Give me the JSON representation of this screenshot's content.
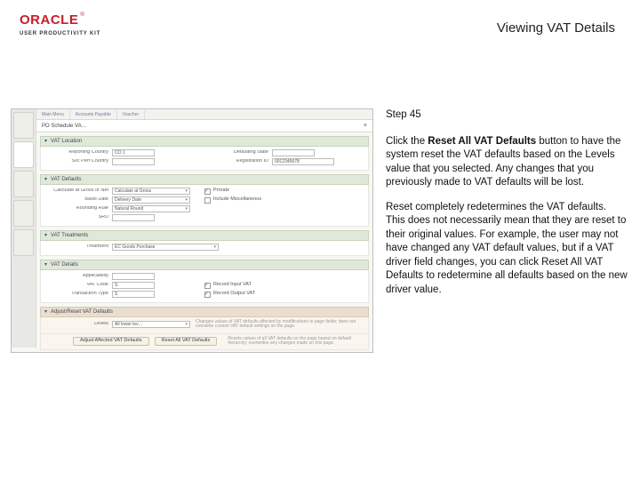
{
  "header": {
    "logo_main": "ORACLE",
    "logo_tm": "®",
    "logo_sub": "USER PRODUCTIVITY KIT",
    "page_title": "Viewing VAT Details"
  },
  "instruction": {
    "step_label": "Step 45",
    "para1_pre": "Click the ",
    "para1_bold": "Reset All VAT Defaults",
    "para1_post": " button to have the system reset the VAT defaults based on the Levels value that you selected. Any changes that you previously made to VAT defaults will be lost.",
    "para2": "Reset completely redetermines the VAT defaults. This does not necessarily mean that they are reset to their original values. For example, the user may not have changed any VAT default values, but if a VAT driver field changes, you can click Reset All VAT Defaults to redetermine all defaults based on the new driver value."
  },
  "app": {
    "tabs": [
      "Main Menu",
      "Accounts Payable",
      "Voucher"
    ],
    "win_title": "PO Schedule VA…",
    "sec_location": {
      "title": "VAT Location"
    },
    "loc": {
      "reporting_country_lbl": "Reporting Country",
      "reporting_country_val": "CO 1",
      "registration_id_lbl": "Registration ID",
      "registration_id_val": "0012345678",
      "defaulting_state_lbl": "Defaulting State",
      "svc_perf_country_lbl": "Svc Perf Country"
    },
    "sec_defaults": {
      "title": "VAT Defaults"
    },
    "def": {
      "calc_gross_lbl": "Calculate at Gross or Net",
      "calc_gross_val": "Calculate at Gross",
      "basis_lbl": "Basis Date",
      "basis_val": "Delivery Date",
      "rounding_lbl": "Rounding Rule",
      "rounding_val": "Natural Round",
      "sru_lbl": "SRU",
      "prorate_lbl": "Prorate",
      "include_misc_lbl": "Include Miscellaneous"
    },
    "sec_treatments": {
      "title": "VAT Treatments"
    },
    "trt": {
      "treatment_lbl": "Treatment",
      "treatment_val": "EC Goods Purchase"
    },
    "sec_details": {
      "title": "VAT Details"
    },
    "det": {
      "applicability_lbl": "Applicability",
      "vat_code_lbl": "VAT Code",
      "vat_code_val": "S",
      "txn_type_lbl": "Transaction Type",
      "txn_type_val": "S",
      "record_input_lbl": "Record Input VAT",
      "record_output_lbl": "Record Output VAT"
    },
    "sec_adjust": {
      "title": "Adjust/Reset VAT Defaults"
    },
    "adj": {
      "levels_lbl": "Levels",
      "levels_val": "All lower lev…",
      "adjust_btn": "Adjust Affected VAT Defaults",
      "adjust_hint": "Changes values of VAT defaults affected by modifications to page fields; does not overwrite custom VAT default settings on the page.",
      "reset_btn": "Reset All VAT Defaults",
      "reset_hint": "Resets values of all VAT defaults on the page based on default hierarchy; overwrites any changes made on this page."
    }
  }
}
